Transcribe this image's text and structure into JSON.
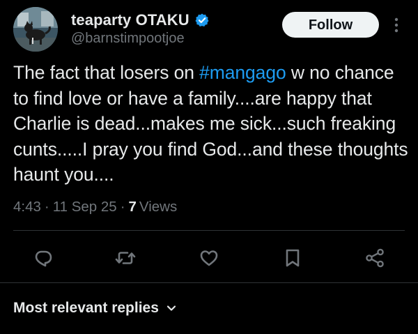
{
  "author": {
    "display_name": "teaparty OTAKU",
    "handle": "@barnstimpootjoe",
    "verified": true
  },
  "follow_button": {
    "label": "Follow"
  },
  "tweet": {
    "text_before": "The fact that losers on ",
    "hashtag": "#mangago",
    "text_after": " w no chance to find love or have a family....are happy that Charlie is dead...makes me sick...such freaking cunts.....I pray you find God...and these thoughts haunt you...."
  },
  "meta": {
    "time": "4:43",
    "separator": "·",
    "date": "11 Sep 25",
    "views_count": "7",
    "views_label": "Views"
  },
  "actions": {
    "reply": "reply-icon",
    "retweet": "retweet-icon",
    "like": "heart-icon",
    "bookmark": "bookmark-icon",
    "share": "share-icon"
  },
  "replies_sort": {
    "label": "Most relevant replies"
  },
  "colors": {
    "background": "#000000",
    "text": "#e7e9ea",
    "secondary": "#71767b",
    "accent": "#1d9bf0",
    "follow_bg": "#eff3f4"
  }
}
